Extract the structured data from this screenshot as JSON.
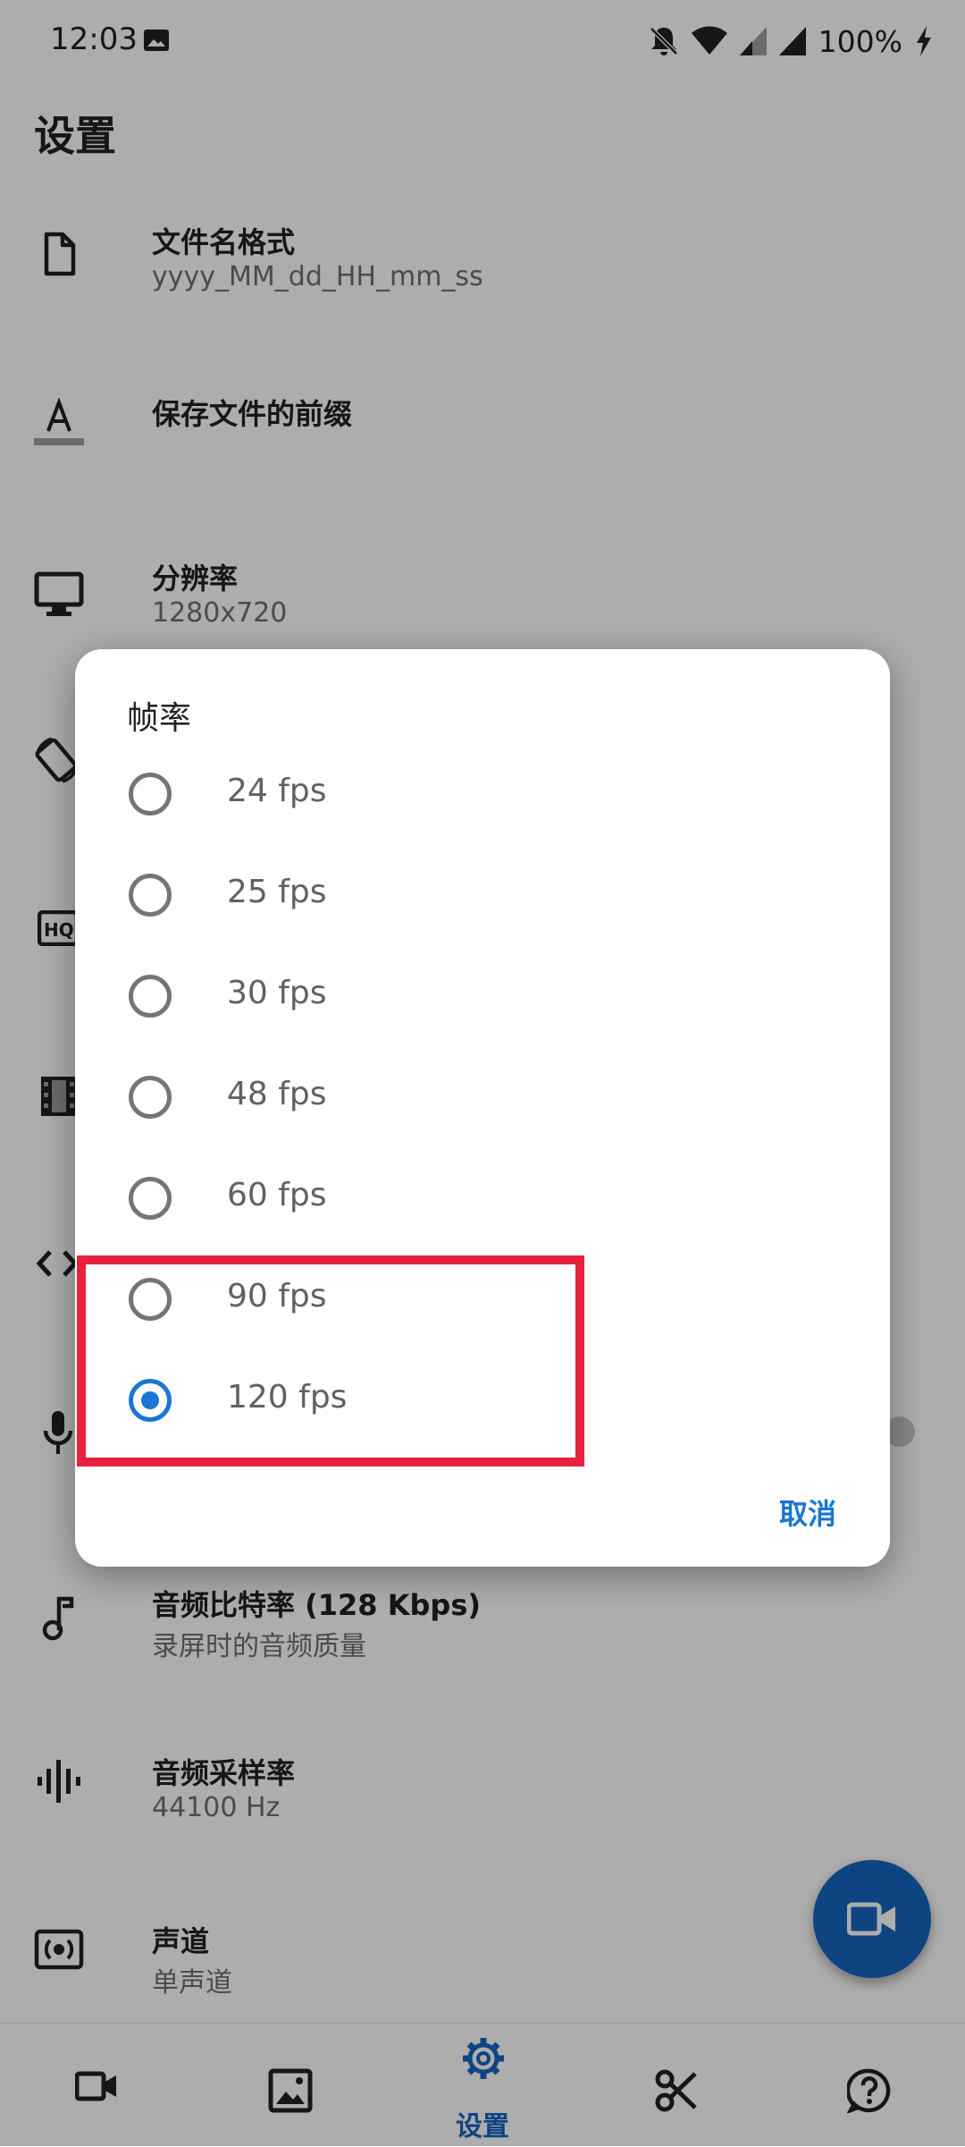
{
  "status_bar": {
    "time": "12:03",
    "battery": "100%"
  },
  "page": {
    "title": "设置"
  },
  "settings": {
    "filename_format": {
      "title": "文件名格式",
      "value": "yyyy_MM_dd_HH_mm_ss",
      "icon": "file-icon"
    },
    "save_prefix": {
      "title": "保存文件的前缀",
      "icon": "text-format-icon"
    },
    "resolution": {
      "title": "分辨率",
      "value": "1280x720",
      "icon": "monitor-icon"
    },
    "audio_bitrate": {
      "title": "音频比特率 (128 Kbps)",
      "value": "录屏时的音频质量",
      "icon": "music-note-icon"
    },
    "sample_rate": {
      "title": "音频采样率",
      "value": "44100 Hz",
      "icon": "waveform-icon"
    },
    "channel": {
      "title": "声道",
      "value": "单声道",
      "icon": "surround-sound-icon"
    }
  },
  "dialog": {
    "title": "帧率",
    "options": [
      {
        "label": "24 fps",
        "selected": false
      },
      {
        "label": "25 fps",
        "selected": false
      },
      {
        "label": "30 fps",
        "selected": false
      },
      {
        "label": "48 fps",
        "selected": false
      },
      {
        "label": "60 fps",
        "selected": false
      },
      {
        "label": "90 fps",
        "selected": false
      },
      {
        "label": "120 fps",
        "selected": true
      }
    ],
    "cancel_label": "取消"
  },
  "bottom_nav": {
    "items": [
      {
        "icon": "video-camera-icon",
        "active": false
      },
      {
        "icon": "gallery-icon",
        "active": false
      },
      {
        "icon": "gear-icon",
        "label": "设置",
        "active": true
      },
      {
        "icon": "scissors-icon",
        "active": false
      },
      {
        "icon": "help-icon",
        "active": false
      }
    ]
  },
  "colors": {
    "accent": "#1976d2",
    "fab": "#1565c0",
    "highlight": "#e8213f",
    "scrim": "rgba(0,0,0,0.32)"
  }
}
